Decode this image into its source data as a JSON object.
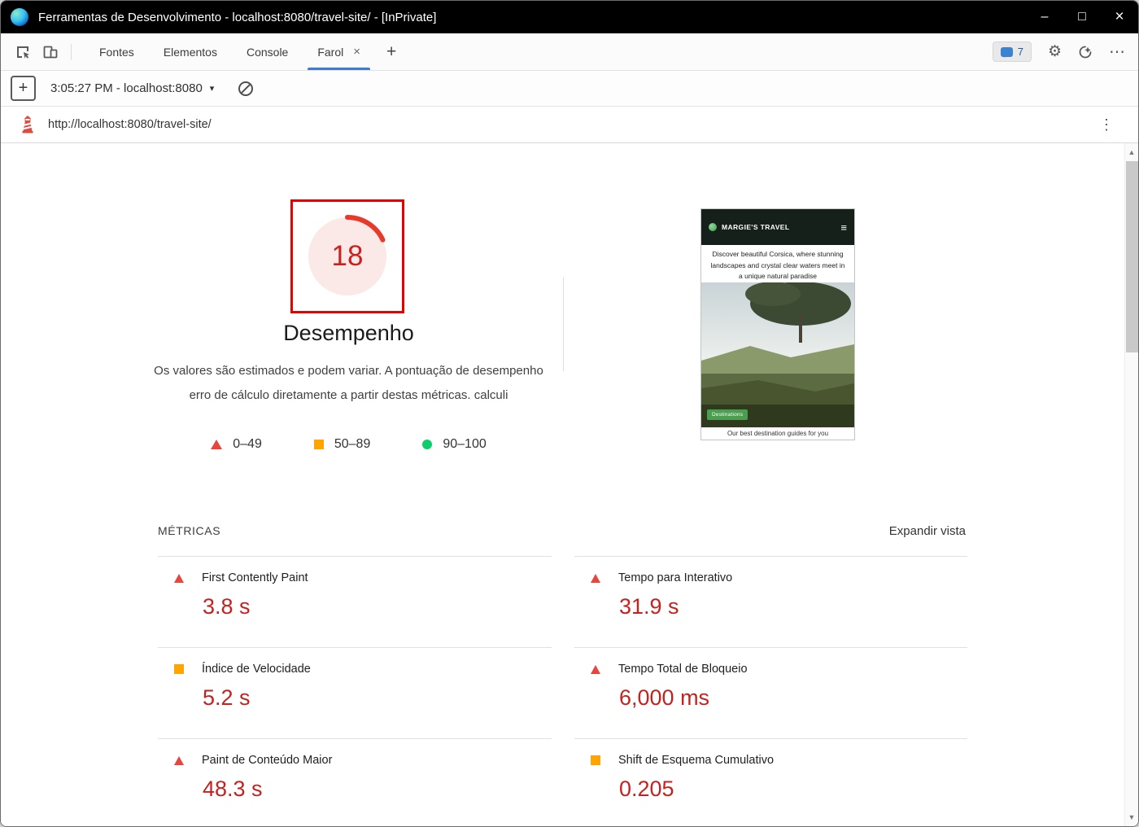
{
  "icons": {
    "minimize": "–",
    "maximize": "□",
    "close": "×",
    "tab_close": "×",
    "plus": "+",
    "dropdown": "▾",
    "gear": "⚙",
    "more_h": "⋯",
    "kebab": "⋮",
    "hamburger": "≡",
    "scroll_up": "▲",
    "scroll_down": "▼"
  },
  "window": {
    "title": "Ferramentas de Desenvolvimento - localhost:8080/travel-site/ - [InPrivate]"
  },
  "toolbar": {
    "tabs": [
      {
        "label": "Fontes"
      },
      {
        "label": "Elementos"
      },
      {
        "label": "Console"
      },
      {
        "label": "Farol",
        "active": true
      }
    ],
    "issues_badge": "7"
  },
  "session_bar": {
    "session": "3:05:27 PM - localhost:8080"
  },
  "url_bar": {
    "url": "http://localhost:8080/travel-site/"
  },
  "report": {
    "score": "18",
    "category": "Desempenho",
    "disclaimer_line1": "Os valores são estimados e podem variar. A pontuação de desempenho",
    "disclaimer_line2": "erro de cálculo diretamente a partir destas métricas. calculi",
    "legend": [
      {
        "label": "0–49",
        "shape": "triangle",
        "color": "#e8453c"
      },
      {
        "label": "50–89",
        "shape": "square",
        "color": "#ffa400"
      },
      {
        "label": "90–100",
        "shape": "circle",
        "color": "#0cce6b"
      }
    ],
    "metrics_title": "MÉTRICAS",
    "expand_label": "Expandir vista",
    "metrics": [
      {
        "label": "First Contently Paint",
        "value": "3.8 s",
        "rating": "fail"
      },
      {
        "label": "Tempo para Interativo",
        "value": "31.9 s",
        "rating": "fail"
      },
      {
        "label": "Índice de Velocidade",
        "value": "5.2 s",
        "rating": "average"
      },
      {
        "label": "Tempo Total de Bloqueio",
        "value": "6,000 ms",
        "rating": "fail"
      },
      {
        "label": "Paint de Conteúdo Maior",
        "value": "48.3 s",
        "rating": "fail"
      },
      {
        "label": "Shift de Esquema Cumulativo",
        "value": "0.205",
        "rating": "average"
      }
    ]
  },
  "thumbnail": {
    "brand": "MARGIE'S TRAVEL",
    "tagline": "Discover beautiful Corsica, where stunning landscapes and crystal clear waters meet in a unique natural paradise",
    "cta": "Destinations",
    "footer": "Our best destination guides for you"
  }
}
